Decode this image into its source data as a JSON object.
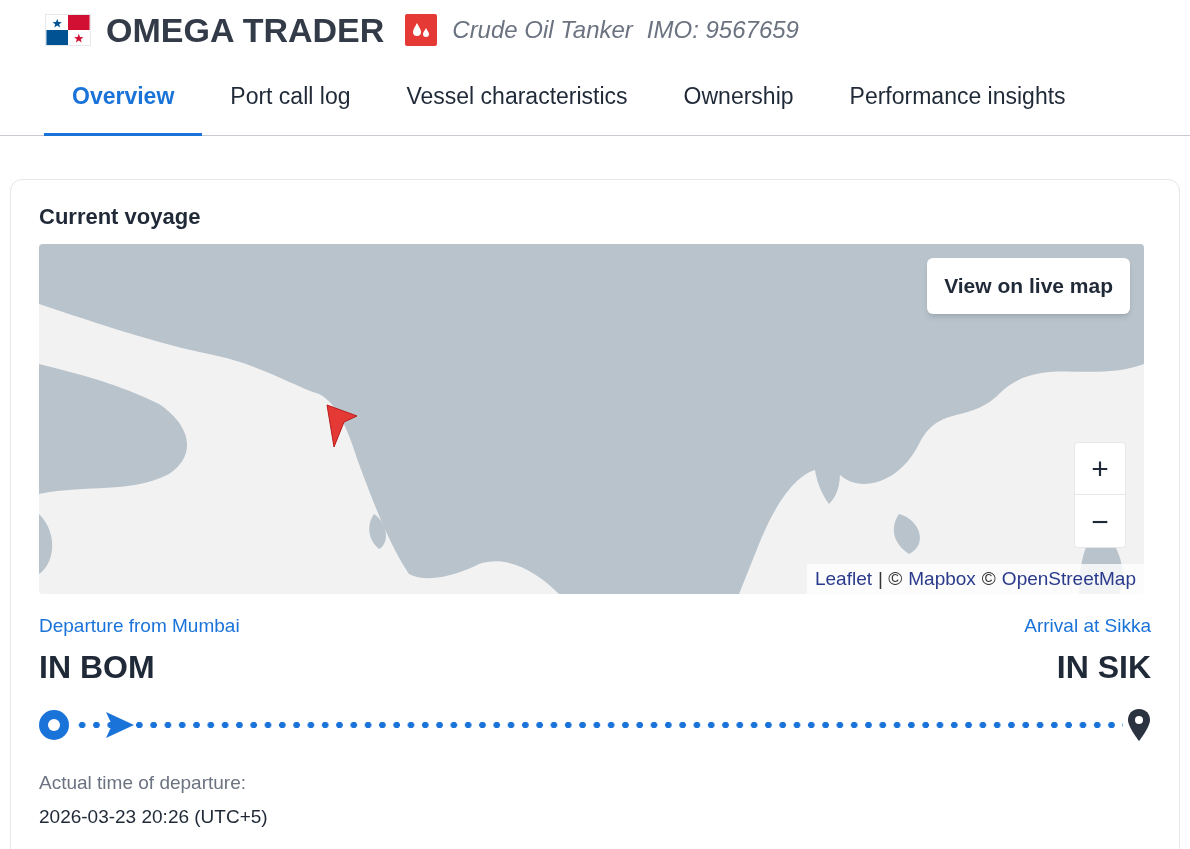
{
  "vessel": {
    "name": "OMEGA TRADER",
    "type": "Crude Oil Tanker",
    "imo": "IMO: 9567659"
  },
  "tabs": [
    {
      "label": "Overview",
      "selected": true
    },
    {
      "label": "Port call log",
      "selected": false
    },
    {
      "label": "Vessel characteristics",
      "selected": false
    },
    {
      "label": "Ownership",
      "selected": false
    },
    {
      "label": "Performance insights",
      "selected": false
    }
  ],
  "voyage": {
    "title": "Current voyage",
    "map": {
      "kind": "picture",
      "button": "View on live map",
      "zoom_in": "+",
      "zoom_out": "−",
      "attribution": [
        {
          "kind": "link",
          "text": "Leaflet"
        },
        {
          "kind": "text",
          "text": "| ©"
        },
        {
          "kind": "link",
          "text": "Mapbox"
        },
        {
          "kind": "text",
          "text": "©"
        },
        {
          "kind": "link",
          "text": "OpenStreetMap"
        }
      ]
    },
    "departure": {
      "label": "Departure from Mumbai",
      "code": "IN BOM"
    },
    "arrival": {
      "label": "Arrival at Sikka",
      "code": "IN SIK"
    },
    "progress": {
      "level": 0.03
    },
    "atd_label": "Actual time of departure:",
    "atd_value": "2026-03-23 20:26 (UTC+5)"
  }
}
